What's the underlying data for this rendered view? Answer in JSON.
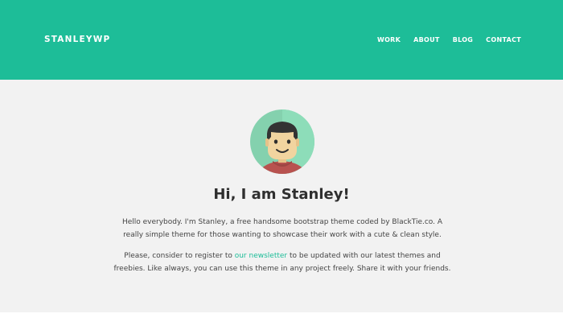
{
  "header": {
    "brand": "STANLEYWP",
    "nav": [
      "WORK",
      "ABOUT",
      "BLOG",
      "CONTACT"
    ]
  },
  "hero": {
    "title": "Hi, I am Stanley!",
    "intro": "Hello everybody. I'm Stanley, a free handsome bootstrap theme coded by BlackTie.co. A really simple theme for those wanting to showcase their work with a cute & clean style.",
    "newsletter_before": "Please, consider to register to ",
    "newsletter_link": "our newsletter",
    "newsletter_after": " to be updated with our latest themes and freebies. Like always, you can use this theme in any project freely. Share it with your friends."
  },
  "colors": {
    "accent": "#1dbd98",
    "background": "#f2f2f2",
    "title": "#2f2f2f",
    "text": "#444444"
  },
  "icons": {
    "avatar": "cartoon-face-avatar-icon"
  }
}
